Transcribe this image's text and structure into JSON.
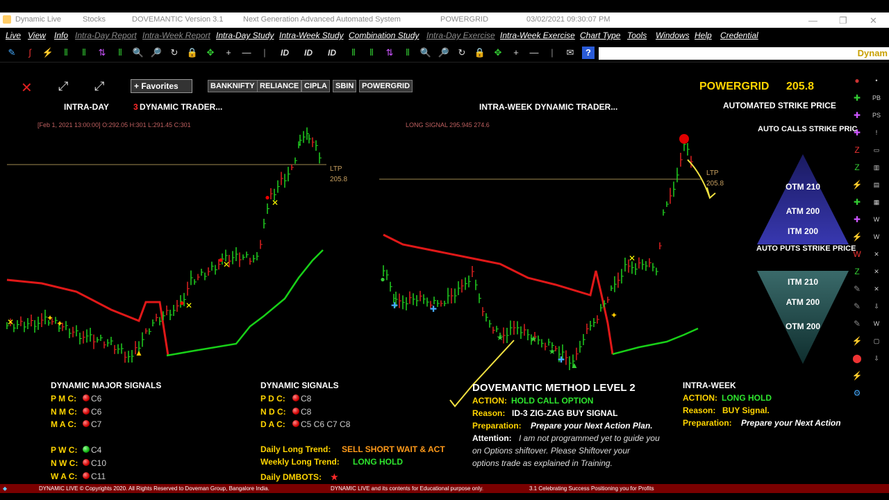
{
  "titlebar": {
    "app": "Dynamic Live",
    "stocks": "Stocks",
    "version": "DOVEMANTIC Version 3.1",
    "tagline": "Next Generation Advanced Automated System",
    "symbol": "POWERGRID",
    "datetime": "03/02/2021   09:30:07 PM"
  },
  "menu": [
    {
      "label": "Live",
      "active": true
    },
    {
      "label": "View",
      "active": true
    },
    {
      "label": "Info",
      "active": true
    },
    {
      "label": "Intra-Day Report",
      "active": false
    },
    {
      "label": "Intra-Week Report",
      "active": false
    },
    {
      "label": "Intra-Day Study",
      "active": true
    },
    {
      "label": "Intra-Week Study",
      "active": true
    },
    {
      "label": "Combination Study",
      "active": true
    },
    {
      "label": "Intra-Day Exercise",
      "active": false
    },
    {
      "label": "Intra-Week Exercise",
      "active": true
    },
    {
      "label": "Chart Type",
      "active": true
    },
    {
      "label": "Tools",
      "active": true
    },
    {
      "label": "Windows",
      "active": true
    },
    {
      "label": "Help",
      "active": true
    },
    {
      "label": "Credential",
      "active": true
    }
  ],
  "toolbar_icons": [
    "pen-icon",
    "draw-icon",
    "lightning-icon",
    "bar-icon",
    "bar-icon",
    "arrows-icon",
    "bar-icon",
    "zoom-in-icon",
    "zoom-out-icon",
    "refresh-icon",
    "lock-icon",
    "move-icon",
    "plus-icon",
    "minus-icon",
    "divider",
    "id-icon",
    "id-icon",
    "id-icon",
    "bar-icon",
    "bar-icon",
    "arrows-icon",
    "bar-icon",
    "zoom-in-icon",
    "zoom-out-icon",
    "refresh-icon",
    "lock-icon",
    "move-icon",
    "plus-icon",
    "minus-icon",
    "divider",
    "mail-icon",
    "help-icon"
  ],
  "marquee": "Dynam",
  "favorites": {
    "button": "+ Favorites",
    "symbols": [
      "BANKNIFTY",
      "RELIANCE",
      "CIPLA",
      "SBIN",
      "POWERGRID"
    ]
  },
  "header": {
    "symbol": "POWERGRID",
    "price": "205.8",
    "automated": "AUTOMATED STRIKE PRICE",
    "calls": "AUTO CALLS STRIKE PRIC",
    "puts": "AUTO PUTS STRIKE PRICE"
  },
  "calls_strikes": [
    "OTM 210",
    "ATM 200",
    "ITM 200"
  ],
  "puts_strikes": [
    "ITM 210",
    "ATM 200",
    "OTM 200"
  ],
  "intraday_chart": {
    "title": "INTRA-DAY",
    "title_num": "3",
    "title2": "DYNAMIC TRADER...",
    "info": "[Feb 1, 2021 13:00:00] O:292.05  H:301  L:291.45  C:301",
    "ltp_label": "LTP",
    "ltp_value": "205.8"
  },
  "intraweek_chart": {
    "title": "INTRA-WEEK DYNAMIC TRADER...",
    "info": "LONG SIGNAL  295.945 274.6",
    "ltp_label": "LTP",
    "ltp_value": "205.8"
  },
  "major_signals": {
    "title": "DYNAMIC MAJOR SIGNALS",
    "rows": [
      {
        "label": "P M C:",
        "status": "red",
        "value": "C6"
      },
      {
        "label": "N M C:",
        "status": "red",
        "value": "C6"
      },
      {
        "label": "M A C:",
        "status": "red",
        "value": "C7"
      },
      {
        "label": "P W C:",
        "status": "green",
        "value": "C4"
      },
      {
        "label": "N W C:",
        "status": "red",
        "value": "C10"
      },
      {
        "label": "W A C:",
        "status": "red",
        "value": "C11"
      }
    ]
  },
  "dynamic_signals": {
    "title": "DYNAMIC SIGNALS",
    "rows": [
      {
        "label": "P D C:",
        "status": "red",
        "value": "C8"
      },
      {
        "label": "N D C:",
        "status": "red",
        "value": "C8"
      },
      {
        "label": "D A C:",
        "status": "red",
        "value": "C5 C6 C7 C8"
      }
    ],
    "daily_label": "Daily Long Trend:",
    "daily_value": "SELL SHORT WAIT & ACT",
    "weekly_label": "Weekly Long Trend:",
    "weekly_value": "LONG HOLD",
    "dmbots_label": "Daily DMBOTS:",
    "dmbots_value": "★"
  },
  "method": {
    "title": "DOVEMANTIC METHOD LEVEL 2",
    "action_label": "ACTION:",
    "action_value": "HOLD CALL OPTION",
    "reason_label": "Reason:",
    "reason_value": "ID-3 ZIG-ZAG BUY SIGNAL",
    "prep_label": "Preparation:",
    "prep_value": "Prepare your Next Action Plan.",
    "attention_label": "Attention:",
    "attention_line1": "I am not programmed yet to guide you",
    "attention_line2": "on Options shiftover. Please Shiftover your",
    "attention_line3": "options trade as explained in Training."
  },
  "intraweek": {
    "title": "INTRA-WEEK",
    "action_label": "ACTION:",
    "action_value": "LONG HOLD",
    "reason_label": "Reason:",
    "reason_value": "BUY Signal.",
    "prep_label": "Preparation:",
    "prep_value": "Prepare your Next Action"
  },
  "footer": {
    "copyright": "DYNAMIC LIVE © Copyrights 2020. All Rights Reserved to Doveman Group, Bangalore India.",
    "edu": "DYNAMIC LIVE and its contents for Educational purpose only.",
    "ver": "3.1 Celebrating Success Positioning you for Profits"
  },
  "colors": {
    "accent": "#ffd400",
    "buy": "#2ee52e",
    "sell": "#ff2a2a",
    "footer": "#7a0000"
  }
}
